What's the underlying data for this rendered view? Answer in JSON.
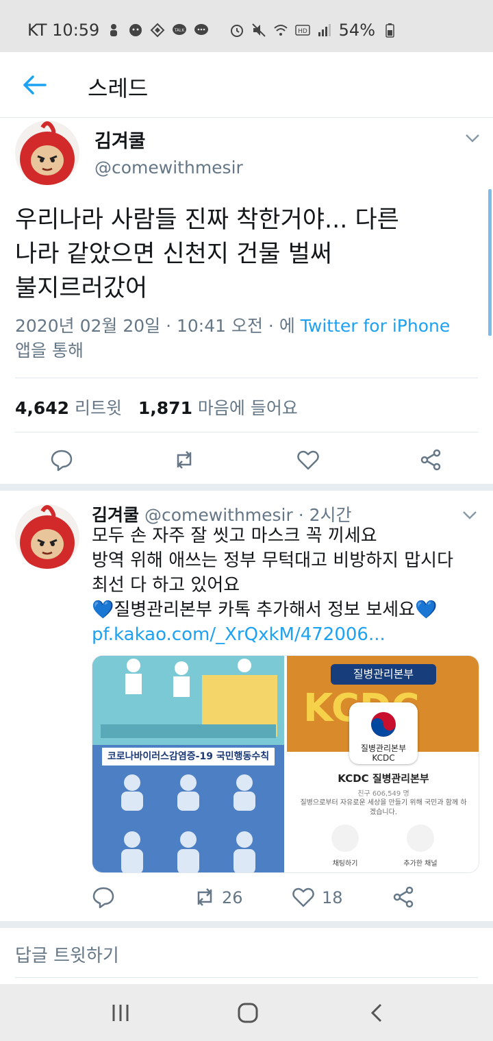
{
  "status_bar": {
    "left_text": "KT 10:59",
    "battery": "54%",
    "left_icons": [
      "person-icon",
      "face-icon",
      "diamond-icon",
      "talk-icon",
      "chat-icon"
    ],
    "right_icons": [
      "alarm-icon",
      "mute-icon",
      "wifi-icon",
      "hd-icon",
      "signal-icon",
      "battery-icon"
    ],
    "talk_label": "TALK",
    "hd_label": "HD"
  },
  "app_bar": {
    "title": "스레드"
  },
  "main_tweet": {
    "name": "김겨쿨",
    "handle": "@comewithmesir",
    "body_lines": [
      "우리나라 사람들 진짜 착한거야... 다른",
      "나라 같았으면 신천지 건물 벌써",
      "불지르러갔어"
    ],
    "meta_prefix": "2020년 02월 20일 · 10:41 오전 · 에 ",
    "meta_link": "Twitter for iPhone",
    "meta_suffix": "앱을 통해",
    "retweet_count": "4,642",
    "retweet_label": "리트윗",
    "like_count": "1,871",
    "like_label": "마음에 들어요"
  },
  "reply_tweet": {
    "name": "김겨쿨",
    "handle": "@comewithmesir",
    "time": "· 2시간",
    "lines": [
      "모두 손 자주 잘 씻고 마스크 꼭 끼세요",
      "방역 위해 애쓰는 정부 무턱대고 비방하지 맙시다",
      "최선 다 하고 있어요"
    ],
    "heart_line_text": "질병관리본부 카톡 추가해서 정보 보세요",
    "heart_glyph": "💙",
    "link": "pf.kakao.com/_XrQxkM/472006...",
    "retweets": "26",
    "likes": "18"
  },
  "media": {
    "left_banner": "코로나바이러스감염증-19 국민행동수칙",
    "right_badge": "질병관리본부",
    "right_big": "KCDC",
    "logo_text_1": "질병관리본부",
    "logo_text_2": "KCDC",
    "channel_title": "KCDC 질병관리본부",
    "friends": "친구 606,549 명",
    "description": "질병으로부터 자유로운 세상을 만들기 위해 국민과 함께 하겠습니다.",
    "button_chat": "채팅하기",
    "button_added": "추가한 채널"
  },
  "reply_bar": {
    "placeholder": "답글 트윗하기"
  },
  "colors": {
    "accent": "#1da1f2",
    "muted": "#657786",
    "text": "#14171a"
  }
}
